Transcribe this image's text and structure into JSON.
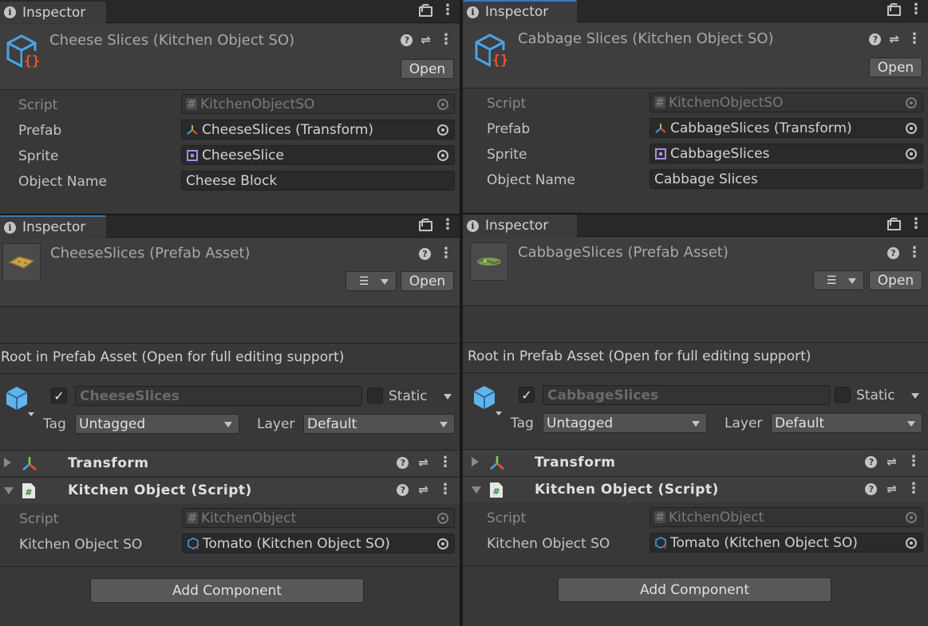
{
  "colors": {
    "accent": "#3a79bb",
    "panel_bg": "#383838",
    "field_bg": "#2a2a2a",
    "button_bg": "#585858"
  },
  "tab_label": "Inspector",
  "panels": {
    "so_left": {
      "title": "Cheese Slices (Kitchen Object SO)",
      "open": "Open",
      "rows": [
        {
          "label": "Script",
          "value": "KitchenObjectSO"
        },
        {
          "label": "Prefab",
          "value": "CheeseSlices (Transform)"
        },
        {
          "label": "Sprite",
          "value": "CheeseSlice"
        },
        {
          "label": "Object Name",
          "value": "Cheese Block"
        }
      ]
    },
    "so_right": {
      "title": "Cabbage Slices (Kitchen Object SO)",
      "open": "Open",
      "rows": [
        {
          "label": "Script",
          "value": "KitchenObjectSO"
        },
        {
          "label": "Prefab",
          "value": "CabbageSlices (Transform)"
        },
        {
          "label": "Sprite",
          "value": "CabbageSlices"
        },
        {
          "label": "Object Name",
          "value": "Cabbage Slices"
        }
      ]
    },
    "pf_left": {
      "title": "CheeseSlices (Prefab Asset)",
      "open": "Open",
      "root_message": "Root in Prefab Asset (Open for full editing support)",
      "name": "CheeseSlices",
      "static": "Static",
      "tag_label": "Tag",
      "tag_value": "Untagged",
      "layer_label": "Layer",
      "layer_value": "Default",
      "transform": "Transform",
      "script_comp": "Kitchen Object (Script)",
      "script_label": "Script",
      "script_value": "KitchenObject",
      "kos_label": "Kitchen Object SO",
      "kos_value": "Tomato (Kitchen Object SO)",
      "add_component": "Add Component"
    },
    "pf_right": {
      "title": "CabbageSlices (Prefab Asset)",
      "open": "Open",
      "root_message": "Root in Prefab Asset (Open for full editing support)",
      "name": "CabbageSlices",
      "static": "Static",
      "tag_label": "Tag",
      "tag_value": "Untagged",
      "layer_label": "Layer",
      "layer_value": "Default",
      "transform": "Transform",
      "script_comp": "Kitchen Object (Script)",
      "script_label": "Script",
      "script_value": "KitchenObject",
      "kos_label": "Kitchen Object SO",
      "kos_value": "Tomato (Kitchen Object SO)",
      "add_component": "Add Component"
    }
  }
}
